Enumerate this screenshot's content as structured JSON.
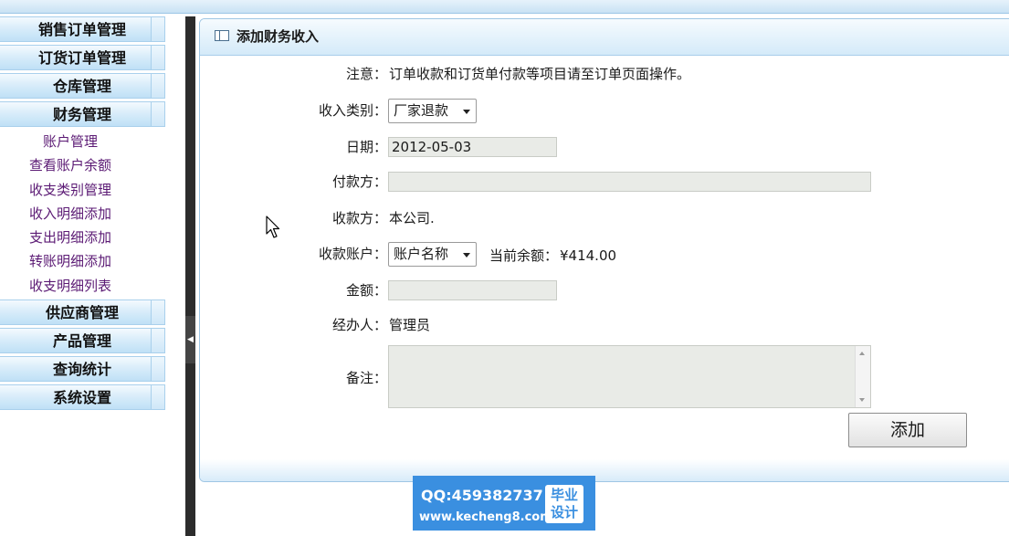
{
  "sidebar": {
    "top_menus": [
      "销售订单管理",
      "订货订单管理",
      "仓库管理",
      "财务管理"
    ],
    "finance_items": [
      "账户管理",
      "查看账户余额",
      "收支类别管理",
      "收入明细添加",
      "支出明细添加",
      "转账明细添加",
      "收支明细列表"
    ],
    "bottom_menus": [
      "供应商管理",
      "产品管理",
      "查询统计",
      "系统设置"
    ]
  },
  "panel": {
    "title": "添加财务收入",
    "note_label": "注意：",
    "note_text": "订单收款和订货单付款等项目请至订单页面操作。",
    "category_label": "收入类别：",
    "category_value": "厂家退款",
    "date_label": "日期：",
    "date_value": "2012-05-03",
    "payer_label": "付款方：",
    "payer_value": "",
    "payee_label": "收款方：",
    "payee_value": "本公司.",
    "account_label": "收款账户：",
    "account_value": "账户名称",
    "balance_label": "当前余额：",
    "balance_value": "¥414.00",
    "amount_label": "金额：",
    "amount_value": "",
    "handler_label": "经办人：",
    "handler_value": "管理员",
    "remark_label": "备注：",
    "remark_value": "",
    "submit_label": "添加"
  },
  "watermark": {
    "qq": "QQ:459382737",
    "site": "www.kecheng8.com",
    "badge_line1": "毕业",
    "badge_line2": "设计"
  }
}
